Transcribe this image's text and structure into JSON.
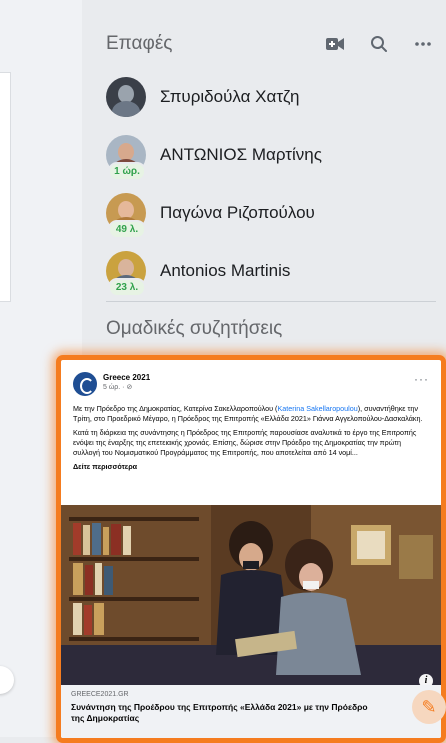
{
  "contacts": {
    "title": "Επαφές",
    "header_icons": [
      "new-room-icon",
      "search-icon",
      "more-icon"
    ],
    "items": [
      {
        "name": "Σπυριδούλα Χατζη",
        "badge": ""
      },
      {
        "name": "ΑΝΤΩΝΙΟΣ Μαρτίνης",
        "badge": "1 ώρ."
      },
      {
        "name": "Παγώνα Ριζοπούλου",
        "badge": "49 λ."
      },
      {
        "name": "Antonios Martinis",
        "badge": "23 λ."
      }
    ],
    "group_title": "Ομαδικές συζητήσεις"
  },
  "post": {
    "page_name": "Greece 2021",
    "time": "5 ώρ. · ⊘",
    "text_intro": "Με την Πρόεδρο της Δημοκρατίας, Κατερίνα Σακελλαροπούλου (",
    "mention": "Katerina Sakellaropoulou",
    "text_rest": "), συναντήθηκε την Τρίτη, στο Προεδρικό Μέγαρο, η Πρόεδρος της Επιτροπής «Ελλάδα 2021» Γιάννα Αγγελοπούλου-Δασκαλάκη.",
    "text_p2": "Κατά τη διάρκεια της συνάντησης η Πρόεδρος της Επιτροπής παρουσίασε αναλυτικά το έργο της Επιτροπής ενόψει της έναρξης της επετειακής χρονιάς. Επίσης, δώρισε στην Πρόεδρο της Δημοκρατίας την πρώτη συλλογή του Νομισματικού Προγράμματος της Επιτροπής, που αποτελείται από 14 νομί...",
    "see_more": "Δείτε περισσότερα",
    "link_domain": "GREECE2021.GR",
    "link_title": "Συνάντηση της Προέδρου της Επιτροπής «Ελλάδα 2021» με την Πρόεδρο της Δημοκρατίας",
    "more": "···",
    "info": "i"
  },
  "colors": {
    "highlight": "#f57c1f",
    "presence_green": "#31a24c",
    "link_blue": "#1877f2"
  }
}
